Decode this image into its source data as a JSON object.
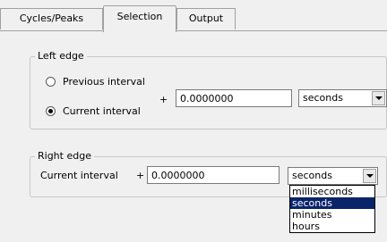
{
  "tabs": [
    {
      "label": "Cycles/Peaks"
    },
    {
      "label": "Selection"
    },
    {
      "label": "Output"
    }
  ],
  "left_edge": {
    "title": "Left edge",
    "radio_previous": "Previous interval",
    "radio_current": "Current interval",
    "selected": "Current interval",
    "plus": "+",
    "offset_value": "0.0000000",
    "unit": "seconds"
  },
  "right_edge": {
    "title": "Right edge",
    "label": "Current interval",
    "plus": "+",
    "offset_value": "0.0000000",
    "unit": "seconds"
  },
  "dropdown": {
    "options": [
      "milliseconds",
      "seconds",
      "minutes",
      "hours"
    ],
    "selected": "seconds"
  }
}
